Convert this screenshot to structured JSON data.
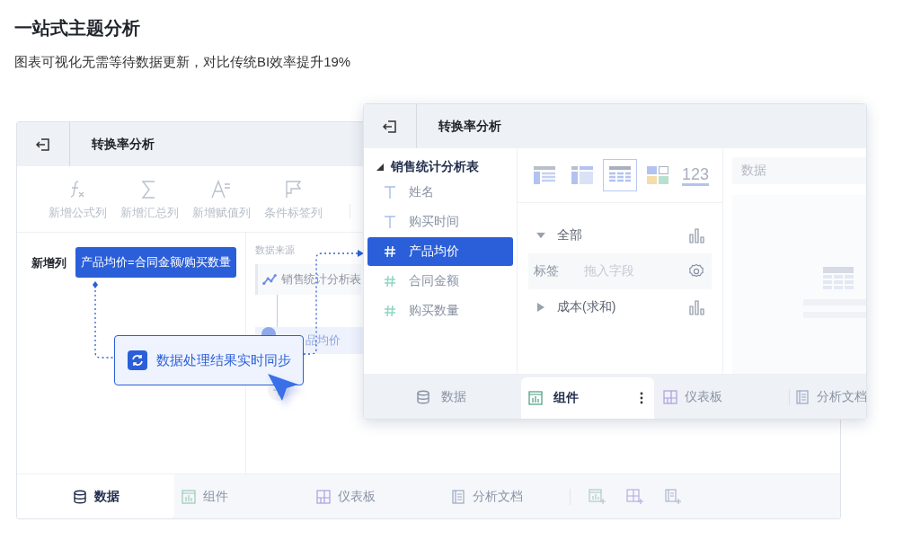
{
  "heading": {
    "title": "一站式主题分析",
    "subtitle": "图表可视化无需等待数据更新，对比传统BI效率提升19%"
  },
  "back_window": {
    "title": "转换率分析",
    "toolbar": [
      {
        "kind": "formula",
        "label": "新增公式列"
      },
      {
        "kind": "sum",
        "label": "新增汇总列"
      },
      {
        "kind": "assign",
        "label": "新增赋值列"
      },
      {
        "kind": "flag",
        "label": "条件标签列"
      }
    ],
    "new_column": {
      "label": "新增列",
      "formula": "产品均价=合同金额/购买数量"
    },
    "source": {
      "label": "数据来源",
      "table": "销售统计分析表",
      "field": "品均价"
    },
    "tabs": [
      {
        "kind": "data",
        "label": "数据",
        "selected": true
      },
      {
        "kind": "component",
        "label": "组件",
        "selected": false
      },
      {
        "kind": "dashboard",
        "label": "仪表板",
        "selected": false
      },
      {
        "kind": "document",
        "label": "分析文档",
        "selected": false
      }
    ]
  },
  "callout": {
    "text": "数据处理结果实时同步"
  },
  "front_window": {
    "title": "转换率分析",
    "tree": {
      "label": "销售统计分析表",
      "expanded": true,
      "children": [
        {
          "kind": "text",
          "label": "姓名",
          "selected": false
        },
        {
          "kind": "text",
          "label": "购买时间",
          "selected": false
        },
        {
          "kind": "number",
          "label": "产品均价",
          "selected": true
        },
        {
          "kind": "number",
          "label": "合同金额",
          "selected": false
        },
        {
          "kind": "number",
          "label": "购买数量",
          "selected": false
        }
      ]
    },
    "chart_types": [
      {
        "kind": "table",
        "selected": false
      },
      {
        "kind": "pivot",
        "selected": false
      },
      {
        "kind": "grid",
        "selected": true
      },
      {
        "kind": "card",
        "selected": false
      },
      {
        "kind": "number",
        "label": "123",
        "selected": false
      }
    ],
    "fields": [
      {
        "kind": "group",
        "label": "全部",
        "expanded": true
      },
      {
        "kind": "slot",
        "label": "标签",
        "placeholder": "拖入字段"
      },
      {
        "kind": "group",
        "label": "成本(求和)",
        "expanded": false
      }
    ],
    "preview": {
      "placeholder": "数据"
    },
    "tabs": [
      {
        "kind": "data",
        "label": "数据",
        "selected": false
      },
      {
        "kind": "component",
        "label": "组件",
        "selected": true
      },
      {
        "kind": "dashboard",
        "label": "仪表板",
        "selected": false
      },
      {
        "kind": "document",
        "label": "分析文档",
        "selected": false
      }
    ]
  }
}
